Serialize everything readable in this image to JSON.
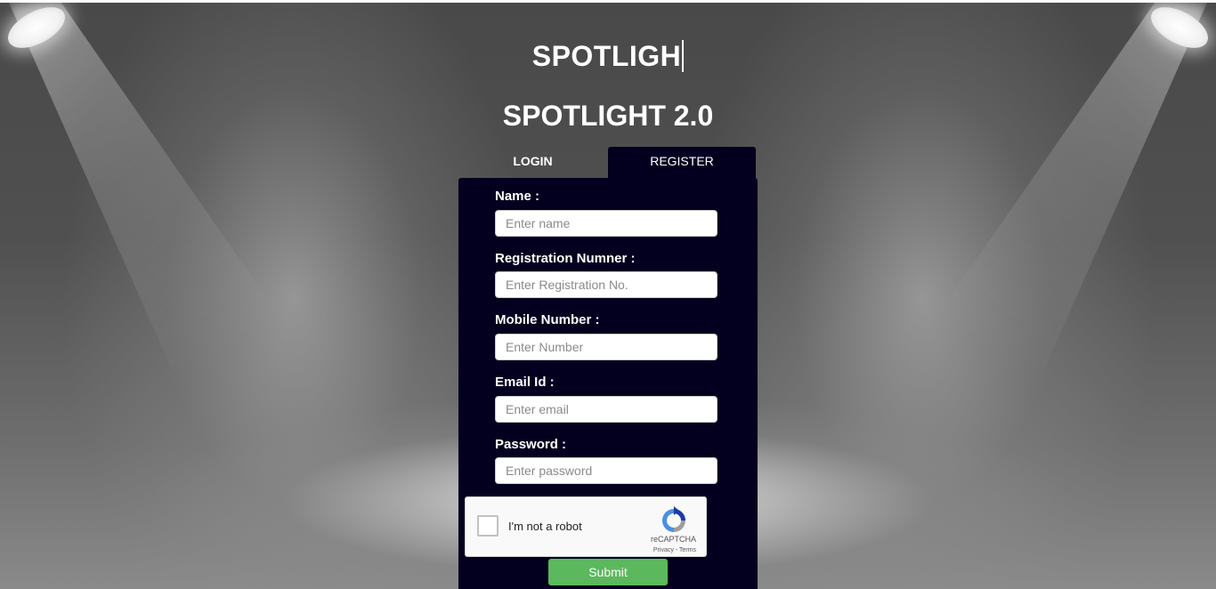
{
  "header": {
    "typing_title": "SPOTLIGH",
    "main_title": "SPOTLIGHT 2.0"
  },
  "tabs": [
    {
      "label": "LOGIN",
      "active": false
    },
    {
      "label": "REGISTER",
      "active": true
    }
  ],
  "form": {
    "fields": [
      {
        "label": "Name :",
        "placeholder": "Enter name",
        "value": ""
      },
      {
        "label": "Registration Numner :",
        "placeholder": "Enter Registration No.",
        "value": ""
      },
      {
        "label": "Mobile Number :",
        "placeholder": "Enter Number",
        "value": ""
      },
      {
        "label": "Email Id :",
        "placeholder": "Enter email",
        "value": ""
      },
      {
        "label": "Password :",
        "placeholder": "Enter password",
        "value": ""
      }
    ],
    "captcha": {
      "label": "I'm not a robot",
      "brand": "reCAPTCHA",
      "links": "Privacy - Terms"
    },
    "submit_label": "Submit"
  },
  "colors": {
    "panel": "#02001e",
    "submit": "#5cb85c",
    "background": "#4b4a4b"
  }
}
